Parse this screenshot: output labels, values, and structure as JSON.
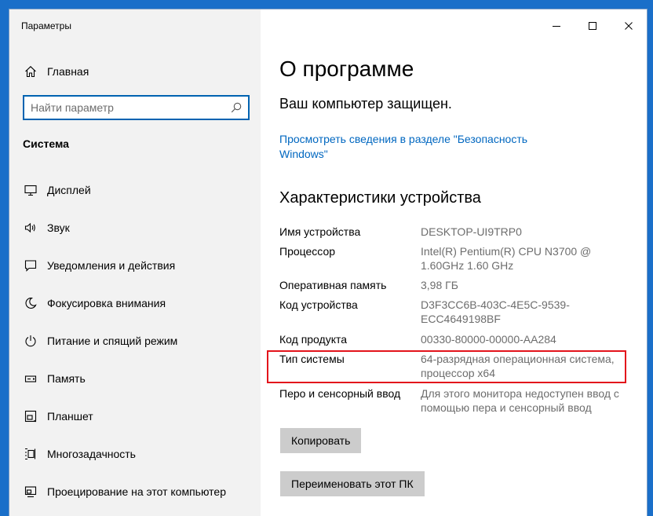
{
  "window": {
    "title": "Параметры",
    "controls": {
      "minimize": "—",
      "maximize": "☐",
      "close": "✕"
    }
  },
  "sidebar": {
    "home_label": "Главная",
    "search_placeholder": "Найти параметр",
    "section_title": "Система",
    "items": [
      {
        "label": "Дисплей",
        "icon": "display-icon"
      },
      {
        "label": "Звук",
        "icon": "sound-icon"
      },
      {
        "label": "Уведомления и действия",
        "icon": "notifications-icon"
      },
      {
        "label": "Фокусировка внимания",
        "icon": "focus-assist-icon"
      },
      {
        "label": "Питание и спящий режим",
        "icon": "power-icon"
      },
      {
        "label": "Память",
        "icon": "storage-icon"
      },
      {
        "label": "Планшет",
        "icon": "tablet-icon"
      },
      {
        "label": "Многозадачность",
        "icon": "multitasking-icon"
      },
      {
        "label": "Проецирование на этот компьютер",
        "icon": "projecting-icon"
      }
    ]
  },
  "main": {
    "title": "О программе",
    "protected_text": "Ваш компьютер защищен.",
    "security_link": "Просмотреть сведения в разделе \"Безопасность Windows\"",
    "specs_title": "Характеристики устройства",
    "specs": [
      {
        "label": "Имя устройства",
        "value": "DESKTOP-UI9TRP0"
      },
      {
        "label": "Процессор",
        "value": "Intel(R) Pentium(R) CPU  N3700  @ 1.60GHz   1.60 GHz"
      },
      {
        "label": "Оперативная память",
        "value": "3,98 ГБ"
      },
      {
        "label": "Код устройства",
        "value": "D3F3CC6B-403C-4E5C-9539-ECC4649198BF"
      },
      {
        "label": "Код продукта",
        "value": "00330-80000-00000-AA284"
      },
      {
        "label": "Тип системы",
        "value": "64-разрядная операционная система, процессор x64"
      },
      {
        "label": "Перо и сенсорный ввод",
        "value": "Для этого монитора недоступен ввод с помощью пера и сенсорный ввод"
      }
    ],
    "copy_button": "Копировать",
    "rename_button": "Переименовать этот ПК"
  },
  "colors": {
    "accent": "#0063b1",
    "link": "#0067c0",
    "highlight": "#e3141b",
    "desktop": "#1a6fc9"
  }
}
